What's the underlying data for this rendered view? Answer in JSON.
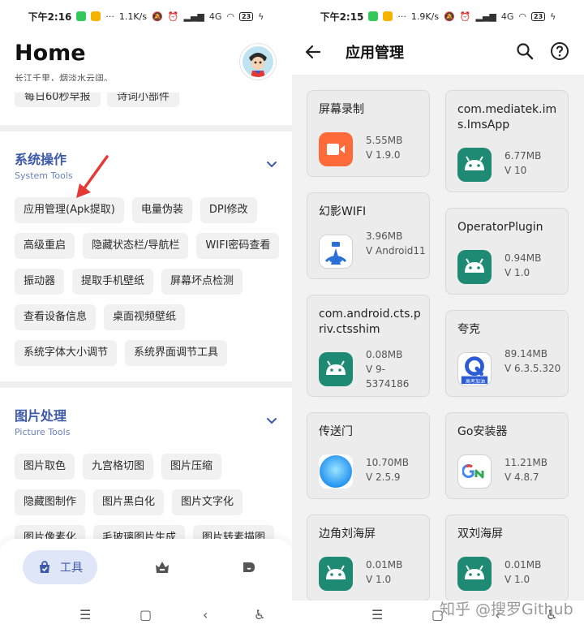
{
  "left": {
    "status": {
      "time": "下午2:16",
      "net": "1.1K/s",
      "sig": "4G",
      "battery": "23"
    },
    "title": "Home",
    "subtitle": "长江千里，烟淡水云阔。",
    "cut_chips": [
      "每日60秒早报",
      "诗词小部件"
    ],
    "system": {
      "title": "系统操作",
      "subtitle": "System Tools",
      "chips": [
        "应用管理(Apk提取)",
        "电量伪装",
        "DPI修改",
        "高级重启",
        "隐藏状态栏/导航栏",
        "WIFI密码查看",
        "振动器",
        "提取手机壁纸",
        "屏幕坏点检测",
        "查看设备信息",
        "桌面视频壁纸",
        "系统字体大小调节",
        "系统界面调节工具"
      ]
    },
    "picture": {
      "title": "图片处理",
      "subtitle": "Picture Tools",
      "chips": [
        "图片取色",
        "九宫格切图",
        "图片压缩",
        "隐藏图制作",
        "图片黑白化",
        "图片文字化",
        "图片像素化",
        "毛玻璃图片生成",
        "图片转素描图"
      ]
    },
    "nav": {
      "tools_label": "工具"
    }
  },
  "right": {
    "status": {
      "time": "下午2:15",
      "net": "1.9K/s",
      "sig": "4G",
      "battery": "23"
    },
    "title": "应用管理",
    "apps_left": [
      {
        "name": "屏幕录制",
        "size": "5.55MB",
        "version": "V 1.9.0",
        "icon": "record-icon"
      },
      {
        "name": "幻影WIFI",
        "size": "3.96MB",
        "version": "V Android11",
        "icon": "wifi-app-icon"
      },
      {
        "name": "com.android.cts.priv.ctsshim",
        "size": "0.08MB",
        "version": "V 9-5374186",
        "icon": "android-icon"
      },
      {
        "name": "传送门",
        "size": "10.70MB",
        "version": "V 2.5.9",
        "icon": "portal-icon"
      },
      {
        "name": "边角刘海屏",
        "size": "0.01MB",
        "version": "V 1.0",
        "icon": "android-icon"
      }
    ],
    "apps_right": [
      {
        "name": "com.mediatek.ims.ImsApp",
        "size": "6.77MB",
        "version": "V 10",
        "icon": "android-icon"
      },
      {
        "name": "OperatorPlugin",
        "size": "0.94MB",
        "version": "V 1.0",
        "icon": "android-icon"
      },
      {
        "name": "夸克",
        "size": "89.14MB",
        "version": "V 6.3.5.320",
        "icon": "quark-icon"
      },
      {
        "name": "Go安装器",
        "size": "11.21MB",
        "version": "V 4.8.7",
        "icon": "go-installer-icon"
      },
      {
        "name": "双刘海屏",
        "size": "0.01MB",
        "version": "V 1.0",
        "icon": "android-icon"
      }
    ],
    "quark_badge": "高考加油",
    "watermark": "知乎 @搜罗Github"
  },
  "colors": {
    "accent": "#3d5aa8",
    "android_green": "#1f8a74",
    "arrow_red": "#e53935"
  }
}
